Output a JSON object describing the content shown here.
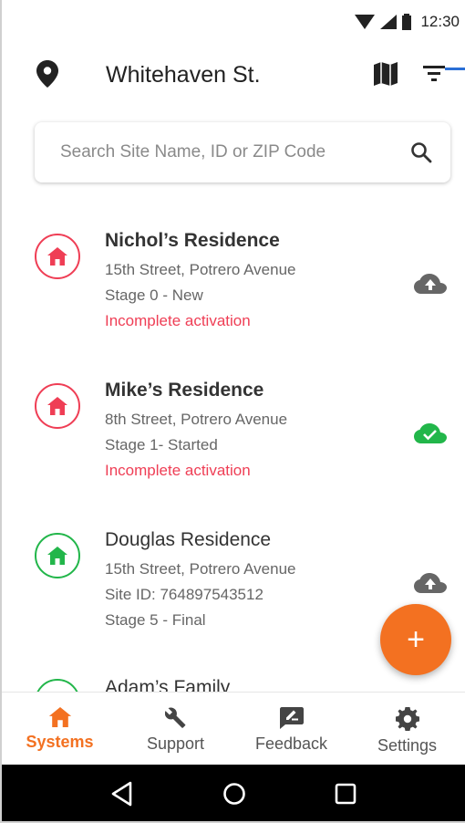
{
  "status_bar": {
    "time": "12:30"
  },
  "header": {
    "title": "Whitehaven St."
  },
  "search": {
    "placeholder": "Search Site Name, ID or ZIP Code"
  },
  "colors": {
    "accent": "#f37121",
    "alert": "#ef3e55",
    "ok": "#22b64a",
    "cloud_gray": "#666666"
  },
  "sites": [
    {
      "name": "Nichol’s Residence",
      "address": "15th Street, Potrero Avenue",
      "stage": "Stage 0 - New",
      "warning": "Incomplete activation",
      "status_icon": "home-red",
      "cloud_icon": "cloud-upload-icon"
    },
    {
      "name": "Mike’s Residence",
      "address": "8th Street, Potrero Avenue",
      "stage": "Stage 1- Started",
      "warning": "Incomplete activation",
      "status_icon": "home-red",
      "cloud_icon": "cloud-done-icon"
    },
    {
      "name": "Douglas Residence",
      "address": "15th Street, Potrero Avenue",
      "site_id": "Site ID: 764897543512",
      "stage": "Stage 5 - Final",
      "status_icon": "home-green",
      "cloud_icon": "cloud-upload-icon"
    },
    {
      "name": "Adam’s Family",
      "status_icon": "home-green"
    }
  ],
  "fab": {
    "label": "+"
  },
  "bottom_nav": [
    {
      "label": "Systems",
      "icon": "home-icon",
      "active": true
    },
    {
      "label": "Support",
      "icon": "wrench-icon",
      "active": false
    },
    {
      "label": "Feedback",
      "icon": "feedback-icon",
      "active": false
    },
    {
      "label": "Settings",
      "icon": "gear-icon",
      "active": false
    }
  ]
}
